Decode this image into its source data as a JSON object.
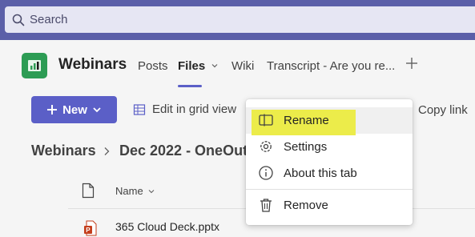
{
  "search": {
    "placeholder": "Search"
  },
  "channel": {
    "team_name": "Webinars",
    "tabs": [
      {
        "label": "Posts",
        "active": false
      },
      {
        "label": "Files",
        "active": true
      },
      {
        "label": "Wiki",
        "active": false
      },
      {
        "label": "Transcript - Are you re...",
        "active": false
      }
    ]
  },
  "toolbar": {
    "new_label": "New",
    "grid_label": "Edit in grid view",
    "copy_link_label": "Copy link"
  },
  "breadcrumb": {
    "root": "Webinars",
    "current": "Dec 2022 - OneOut"
  },
  "file_list": {
    "name_header": "Name",
    "rows": [
      {
        "name": "365 Cloud Deck.pptx"
      }
    ]
  },
  "context_menu": {
    "items": [
      {
        "label": "Rename"
      },
      {
        "label": "Settings"
      },
      {
        "label": "About this tab"
      },
      {
        "label": "Remove"
      }
    ]
  },
  "colors": {
    "titlebar": "#5b5fa8",
    "accent": "#5b5fc7",
    "highlight": "#ecec4a",
    "team_logo": "#2d9c54"
  }
}
